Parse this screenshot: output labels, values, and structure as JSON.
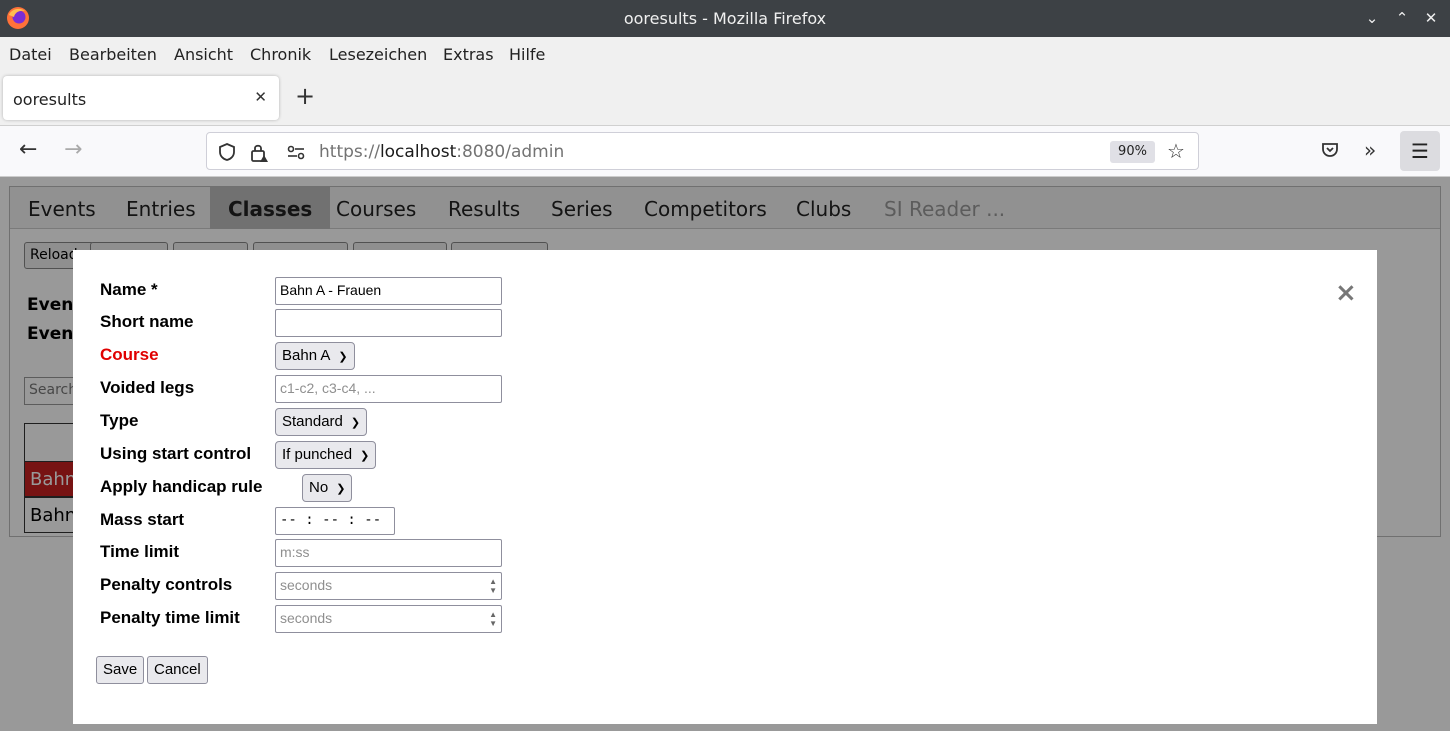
{
  "window": {
    "title": "ooresults - Mozilla Firefox"
  },
  "menubar": [
    {
      "label": "Datei"
    },
    {
      "label": "Bearbeiten"
    },
    {
      "label": "Ansicht"
    },
    {
      "label": "Chronik"
    },
    {
      "label": "Lesezeichen"
    },
    {
      "label": "Extras"
    },
    {
      "label": "Hilfe"
    }
  ],
  "browser_tab": {
    "title": "ooresults"
  },
  "urlbar": {
    "scheme": "https://",
    "host": "localhost",
    "rest": ":8080/admin",
    "zoom": "90%"
  },
  "nav_tabs": [
    {
      "label": "Events"
    },
    {
      "label": "Entries"
    },
    {
      "label": "Classes",
      "active": true
    },
    {
      "label": "Courses"
    },
    {
      "label": "Results"
    },
    {
      "label": "Series"
    },
    {
      "label": "Competitors"
    },
    {
      "label": "Clubs"
    },
    {
      "label": "SI Reader ..."
    }
  ],
  "background": {
    "reload_label": "Reload",
    "event_label_1": "Event",
    "event_label_2": "Event",
    "search_placeholder": "Search",
    "rows": [
      "Bahn",
      "Bahn"
    ]
  },
  "modal": {
    "close": "×",
    "fields": {
      "name": {
        "label": "Name *",
        "value": "Bahn A - Frauen"
      },
      "short_name": {
        "label": "Short name",
        "value": ""
      },
      "course": {
        "label": "Course",
        "value": "Bahn A"
      },
      "voided_legs": {
        "label": "Voided legs",
        "placeholder": "c1-c2, c3-c4, ..."
      },
      "type": {
        "label": "Type",
        "value": "Standard"
      },
      "start_control": {
        "label": "Using start control",
        "value": "If punched"
      },
      "handicap": {
        "label": "Apply handicap rule",
        "value": "No"
      },
      "mass_start": {
        "label": "Mass start",
        "value": "-- : -- : --"
      },
      "time_limit": {
        "label": "Time limit",
        "placeholder": "m:ss"
      },
      "penalty_controls": {
        "label": "Penalty controls",
        "placeholder": "seconds"
      },
      "penalty_time_limit": {
        "label": "Penalty time limit",
        "placeholder": "seconds"
      }
    },
    "save_label": "Save",
    "cancel_label": "Cancel"
  },
  "colors": {
    "required_label": "#e00000",
    "selected_row": "#c62020"
  }
}
